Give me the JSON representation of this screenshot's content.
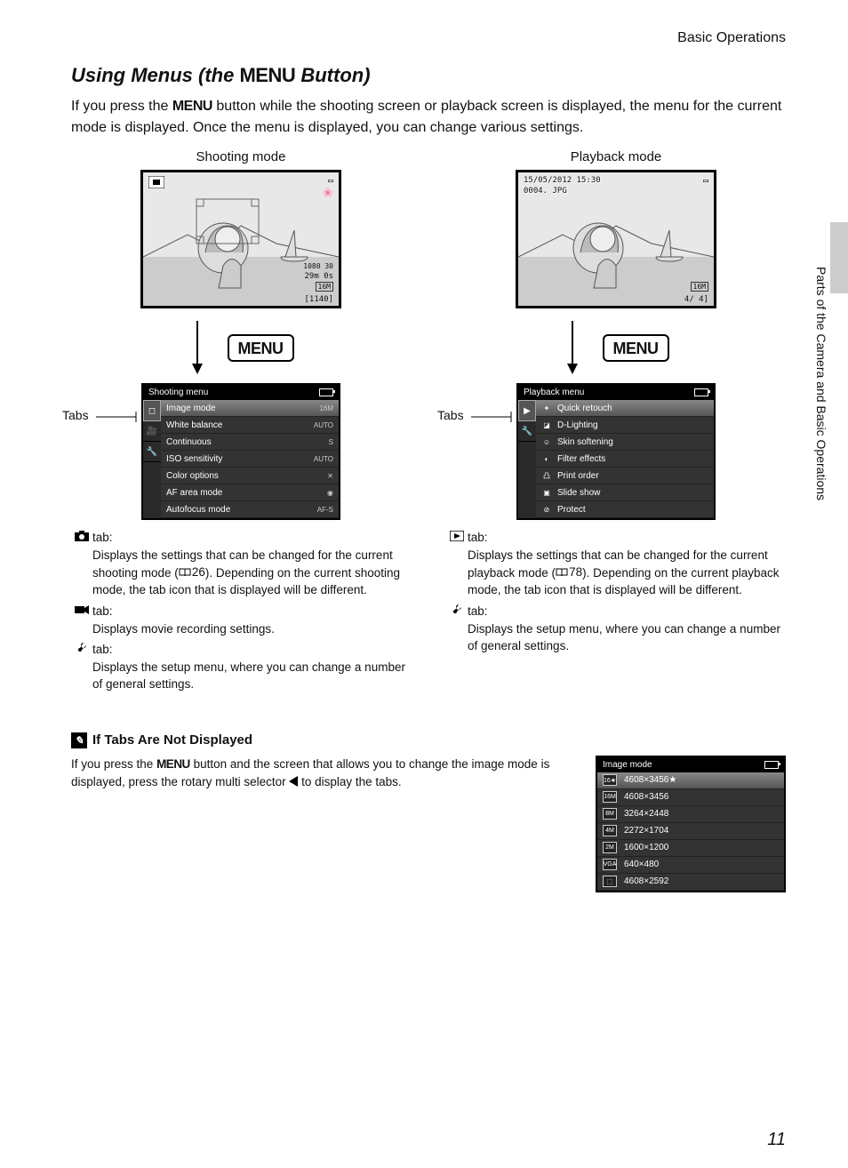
{
  "header": "Basic Operations",
  "title_prefix": "Using Menus (the ",
  "title_menu": "MENU",
  "title_suffix": " Button)",
  "intro": "If you press the MENU button while the shooting screen or playback screen is displayed, the menu for the current mode is displayed. Once the menu is displayed, you can change various settings.",
  "shooting": {
    "label": "Shooting mode",
    "screen": {
      "video": "1080 30",
      "time": "29m 0s",
      "size": "16M",
      "shots": "[1140]"
    },
    "menu_title": "Shooting menu",
    "items": [
      {
        "label": "Image mode",
        "value": "16M"
      },
      {
        "label": "White balance",
        "value": "AUTO"
      },
      {
        "label": "Continuous",
        "value": "S"
      },
      {
        "label": "ISO sensitivity",
        "value": "AUTO"
      },
      {
        "label": "Color options",
        "value": "✕"
      },
      {
        "label": "AF area mode",
        "value": "◉"
      },
      {
        "label": "Autofocus mode",
        "value": "AF-S"
      }
    ],
    "tabs_label": "Tabs",
    "desc": [
      {
        "icon": "camera",
        "label": "tab:",
        "text": "Displays the settings that can be changed for the current shooting mode (📖26). Depending on the current shooting mode, the tab icon that is displayed will be different."
      },
      {
        "icon": "movie",
        "label": "tab:",
        "text": "Displays movie recording settings."
      },
      {
        "icon": "wrench",
        "label": "tab:",
        "text": "Displays the setup menu, where you can change a number of general settings."
      }
    ]
  },
  "playback": {
    "label": "Playback mode",
    "screen": {
      "date": "15/05/2012 15:30",
      "file": "0004. JPG",
      "size": "16M",
      "count": "4/    4]"
    },
    "menu_title": "Playback menu",
    "items": [
      {
        "icon": "✦",
        "label": "Quick retouch"
      },
      {
        "icon": "◪",
        "label": "D-Lighting"
      },
      {
        "icon": "☺",
        "label": "Skin softening"
      },
      {
        "icon": "◐",
        "label": "Filter effects"
      },
      {
        "icon": "凸",
        "label": "Print order"
      },
      {
        "icon": "▣",
        "label": "Slide show"
      },
      {
        "icon": "⊘",
        "label": "Protect"
      }
    ],
    "tabs_label": "Tabs",
    "desc": [
      {
        "icon": "play",
        "label": "tab:",
        "text": "Displays the settings that can be changed for the current playback mode (📖78). Depending on the current playback mode, the tab icon that is displayed will be different."
      },
      {
        "icon": "wrench",
        "label": "tab:",
        "text": "Displays the setup menu, where you can change a number of general settings."
      }
    ]
  },
  "menu_badge": "MENU",
  "note": {
    "title": "If Tabs Are Not Displayed",
    "text_before": "If you press the MENU button and the screen that allows you to change the image mode is displayed, press the rotary multi selector ",
    "text_after": " to display the tabs.",
    "image_mode": {
      "title": "Image mode",
      "items": [
        {
          "badge": "16★",
          "label": "4608×3456★"
        },
        {
          "badge": "16M",
          "label": "4608×3456"
        },
        {
          "badge": "8M",
          "label": "3264×2448"
        },
        {
          "badge": "4M",
          "label": "2272×1704"
        },
        {
          "badge": "2M",
          "label": "1600×1200"
        },
        {
          "badge": "VGA",
          "label": "640×480"
        },
        {
          "badge": "⬚",
          "label": "4608×2592"
        }
      ]
    }
  },
  "sidebar": "Parts of the Camera and Basic Operations",
  "page_number": "11"
}
